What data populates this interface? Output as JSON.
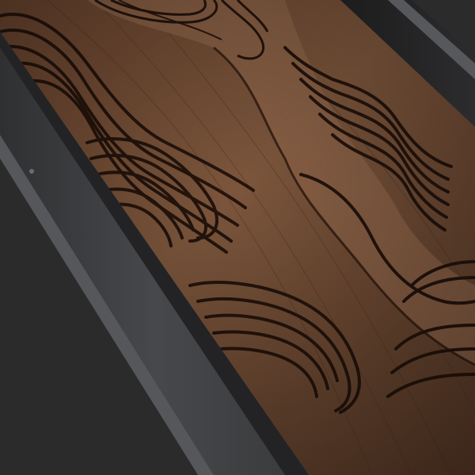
{
  "scene": {
    "subject": "carved-wood-topographic-relief-in-dark-metal-frame",
    "colors": {
      "background": "#2a2a2a",
      "frame_face": "#3c3c3e",
      "frame_edge": "#55575a",
      "wood_base": "#6b4630",
      "wood_light": "#8a6045",
      "wood_dark": "#3e2518",
      "groove": "#24140c"
    }
  }
}
